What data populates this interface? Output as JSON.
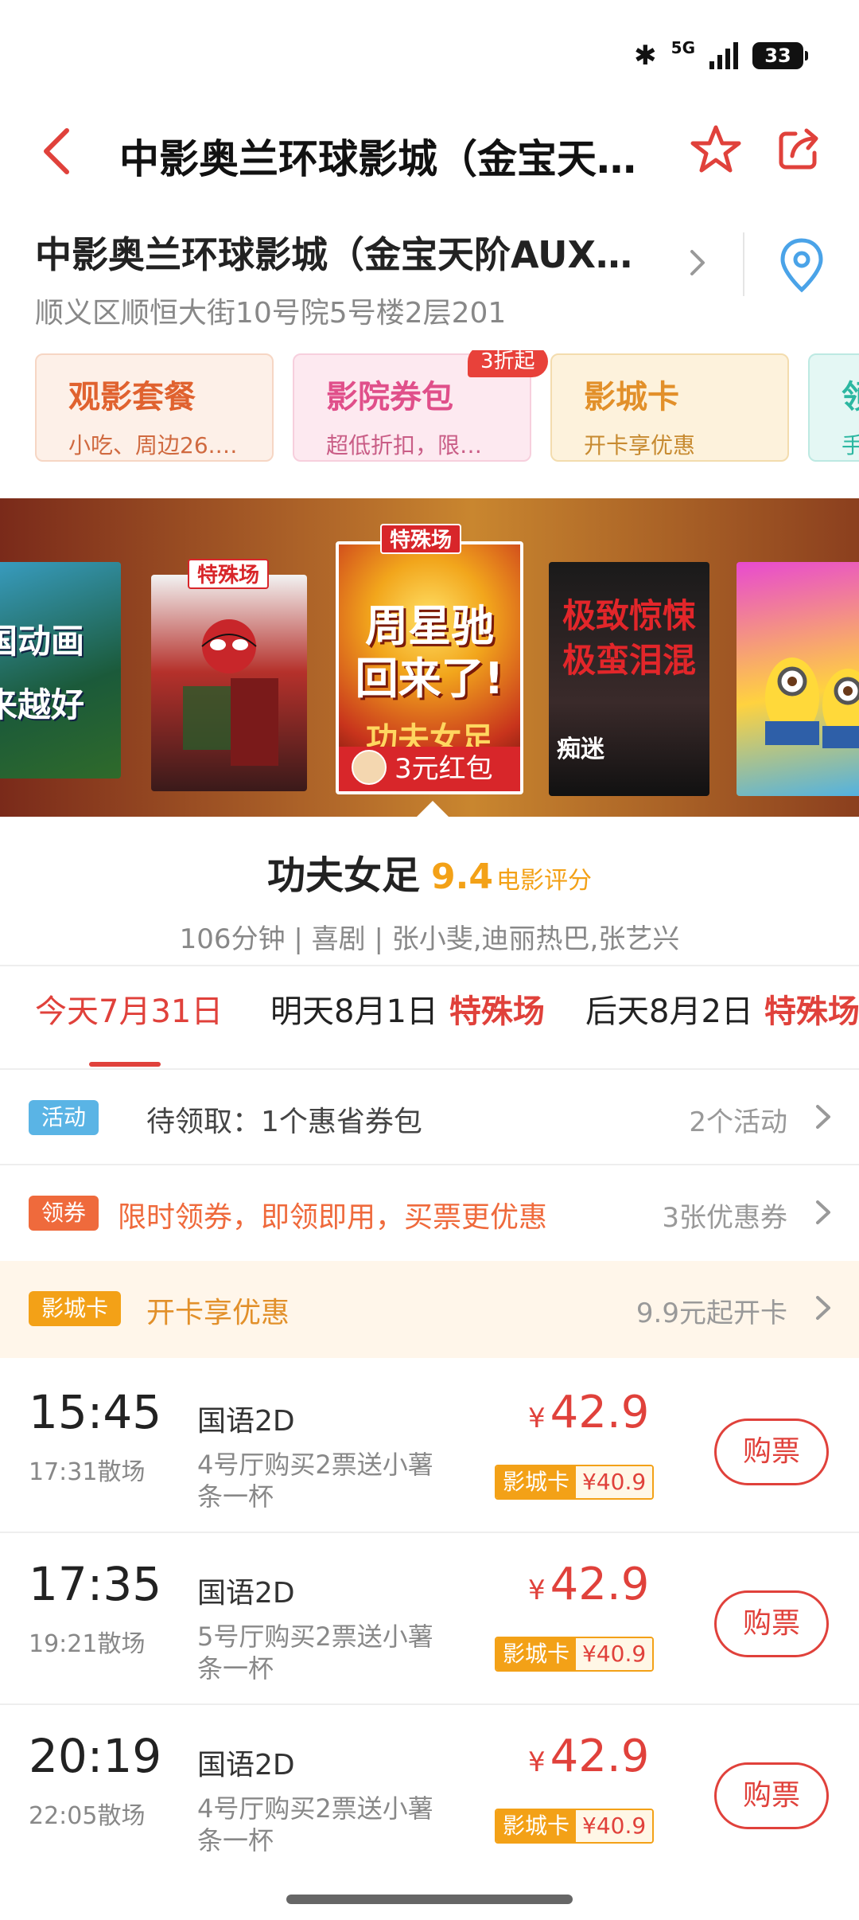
{
  "status": {
    "network": "5G",
    "battery": "33"
  },
  "nav": {
    "title": "中影奥兰环球影城（金宝天…"
  },
  "cinema": {
    "name": "中影奥兰环球影城（金宝天阶AUX…",
    "address": "顺义区顺恒大街10号院5号楼2层201"
  },
  "services": [
    {
      "title": "观影套餐",
      "sub": "小吃、周边26.…"
    },
    {
      "title": "影院券包",
      "sub": "超低折扣，限…",
      "badge": "3折起"
    },
    {
      "title": "影城卡",
      "sub": "开卡享优惠"
    },
    {
      "title": "领",
      "sub": "手"
    }
  ],
  "posters": {
    "p1_text": "国动画\n来越好",
    "p2_tag": "特殊场",
    "p3_tag": "特殊场",
    "p3_title": "周星驰\n回来了!",
    "p3_sub": "功夫女足",
    "p3_redpacket": "3元红包",
    "p4_text": "极致惊悚\n极蛮泪混",
    "p4_small": "痴迷"
  },
  "movie": {
    "title": "功夫女足",
    "score": "9.4",
    "score_label": "电影评分",
    "meta": "106分钟 | 喜剧 | 张小斐,迪丽热巴,张艺兴"
  },
  "dates": [
    {
      "label": "今天7月31日",
      "special": ""
    },
    {
      "label": "明天8月1日",
      "special": "特殊场"
    },
    {
      "label": "后天8月2日",
      "special": "特殊场"
    }
  ],
  "promos": {
    "activity": {
      "tag": "活动",
      "text": "待领取：1个惠省券包",
      "right": "2个活动"
    },
    "coupon": {
      "tag": "领券",
      "text": "限时领券，即领即用，买票更优惠",
      "right": "3张优惠券"
    },
    "card": {
      "tag": "影城卡",
      "text": "开卡享优惠",
      "right": "9.9元起开卡"
    }
  },
  "showtimes": [
    {
      "time": "15:45",
      "end": "17:31散场",
      "lang": "国语2D",
      "desc": "4号厅购买2票送小薯条一杯",
      "currency": "¥",
      "price": "42.9",
      "card_label": "影城卡",
      "card_price": "¥40.9",
      "button": "购票"
    },
    {
      "time": "17:35",
      "end": "19:21散场",
      "lang": "国语2D",
      "desc": "5号厅购买2票送小薯条一杯",
      "currency": "¥",
      "price": "42.9",
      "card_label": "影城卡",
      "card_price": "¥40.9",
      "button": "购票"
    },
    {
      "time": "20:19",
      "end": "22:05散场",
      "lang": "国语2D",
      "desc": "4号厅购买2票送小薯条一杯",
      "currency": "¥",
      "price": "42.9",
      "card_label": "影城卡",
      "card_price": "¥40.9",
      "button": "购票"
    }
  ],
  "colors": {
    "accent": "#e0413b",
    "gold": "#f3a117",
    "activity": "#5ab4e5",
    "coupon": "#ef6a3c"
  }
}
